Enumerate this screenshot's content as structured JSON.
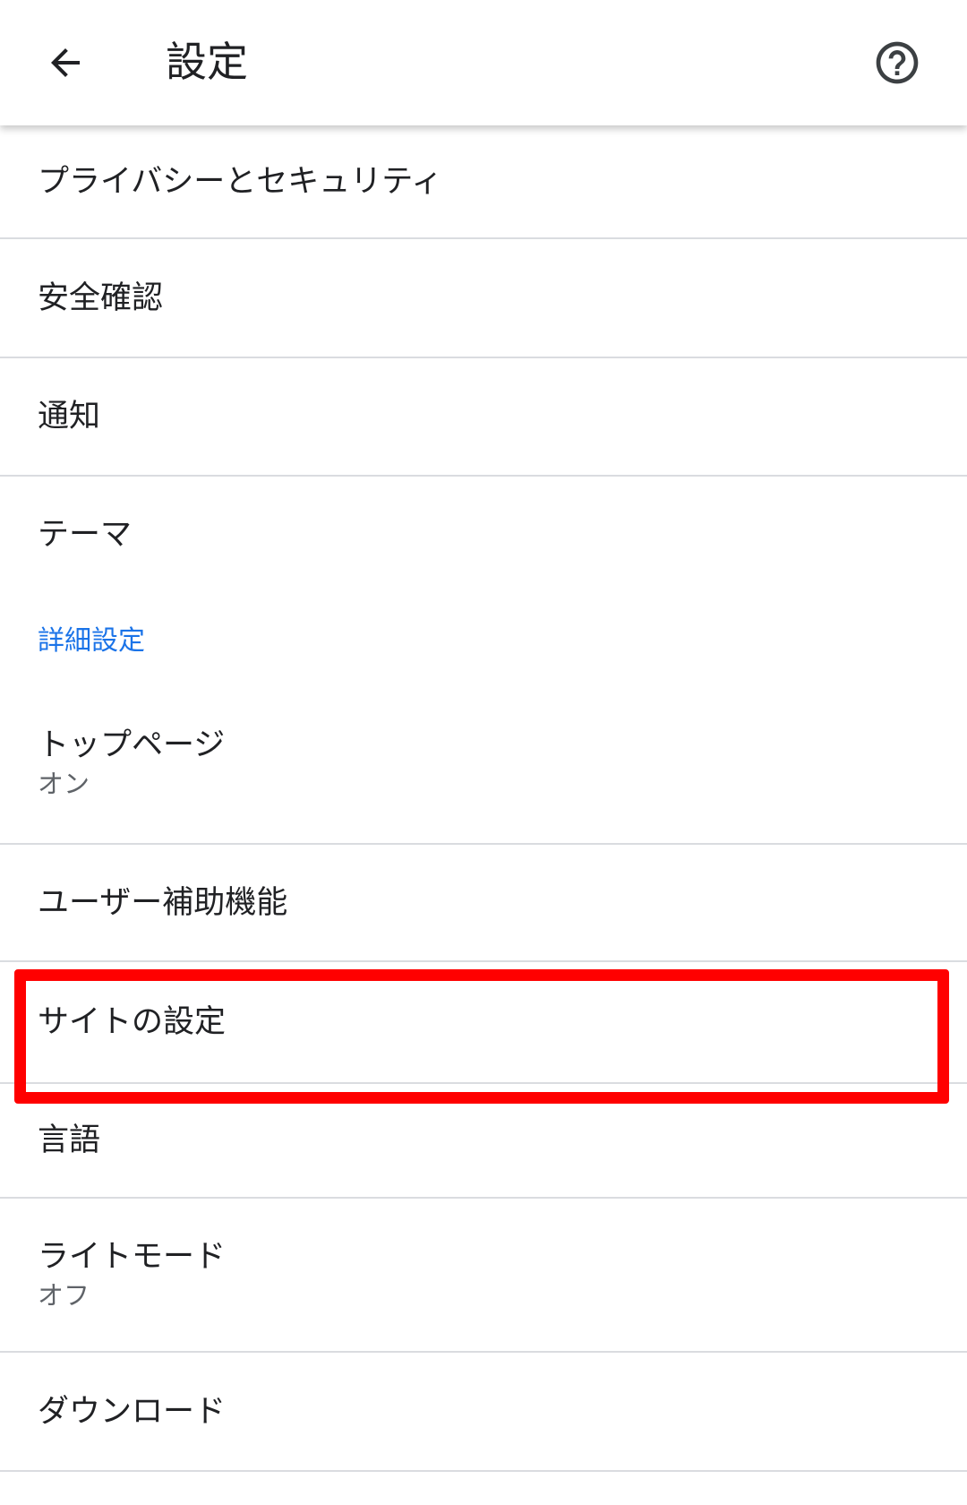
{
  "toolbar": {
    "title": "設定",
    "back_icon": "arrow-left-icon",
    "help_icon": "help-circle-icon"
  },
  "items": [
    {
      "title": "プライバシーとセキュリティ"
    },
    {
      "title": "安全確認"
    },
    {
      "title": "通知"
    },
    {
      "title": "テーマ"
    }
  ],
  "section": {
    "label": "詳細設定"
  },
  "advanced_items": [
    {
      "title": "トップページ",
      "subtitle": "オン"
    },
    {
      "title": "ユーザー補助機能"
    },
    {
      "title": "サイトの設定"
    },
    {
      "title": "言語"
    },
    {
      "title": "ライトモード",
      "subtitle": "オフ"
    },
    {
      "title": "ダウンロード"
    }
  ],
  "colors": {
    "accent": "#1a73e8",
    "highlight": "#ff0000",
    "divider": "#dadce0"
  }
}
